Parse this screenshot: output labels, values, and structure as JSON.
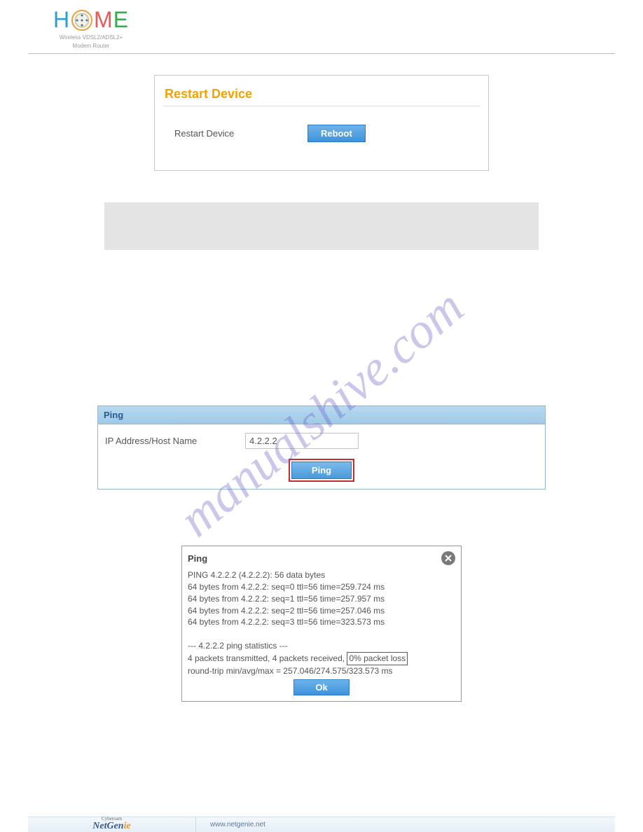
{
  "header": {
    "logo_subtitle_1": "Wireless VDSL2/ADSL2+",
    "logo_subtitle_2": "Modem Router"
  },
  "restart": {
    "title": "Restart Device",
    "label": "Restart Device",
    "button": "Reboot"
  },
  "ping_panel": {
    "title": "Ping",
    "ip_label": "IP Address/Host Name",
    "ip_value": "4.2.2.2",
    "button": "Ping"
  },
  "ping_result": {
    "title": "Ping",
    "line1": "PING 4.2.2.2 (4.2.2.2): 56 data bytes",
    "line2": "64 bytes from 4.2.2.2: seq=0 ttl=56 time=259.724 ms",
    "line3": "64 bytes from 4.2.2.2: seq=1 ttl=56 time=257.957 ms",
    "line4": "64 bytes from 4.2.2.2: seq=2 ttl=56 time=257.046 ms",
    "line5": "64 bytes from 4.2.2.2: seq=3 ttl=56 time=323.573 ms",
    "stats_header": "--- 4.2.2.2 ping statistics ---",
    "stats_line_pre": "4 packets transmitted, 4 packets received, ",
    "stats_highlight": "0% packet loss",
    "rtt_line": "round-trip min/avg/max = 257.046/274.575/323.573 ms",
    "ok_button": "Ok"
  },
  "watermark": "manualshive.com",
  "footer": {
    "tiny": "Cyberoam",
    "brand": "NetGenie",
    "url": "www.netgenie.net"
  }
}
